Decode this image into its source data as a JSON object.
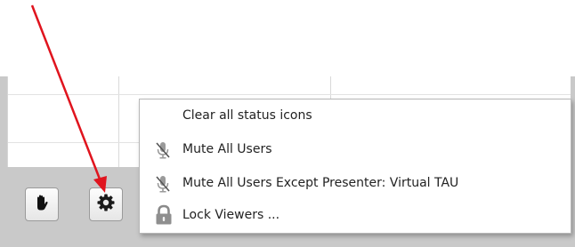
{
  "toolbar": {
    "raise_hand_icon": "raise-hand-icon",
    "settings_icon": "gear-icon"
  },
  "menu": {
    "items": [
      {
        "label": "Clear all status icons",
        "icon": ""
      },
      {
        "label": "Mute All Users",
        "icon": "muted-microphone-icon"
      },
      {
        "label": "Mute All Users Except Presenter: Virtual TAU",
        "icon": "muted-microphone-icon"
      },
      {
        "label": "Lock Viewers ...",
        "icon": "lock-icon"
      }
    ]
  },
  "colors": {
    "annotation_arrow": "#e0141e",
    "panel_background": "#c9c9c9"
  }
}
